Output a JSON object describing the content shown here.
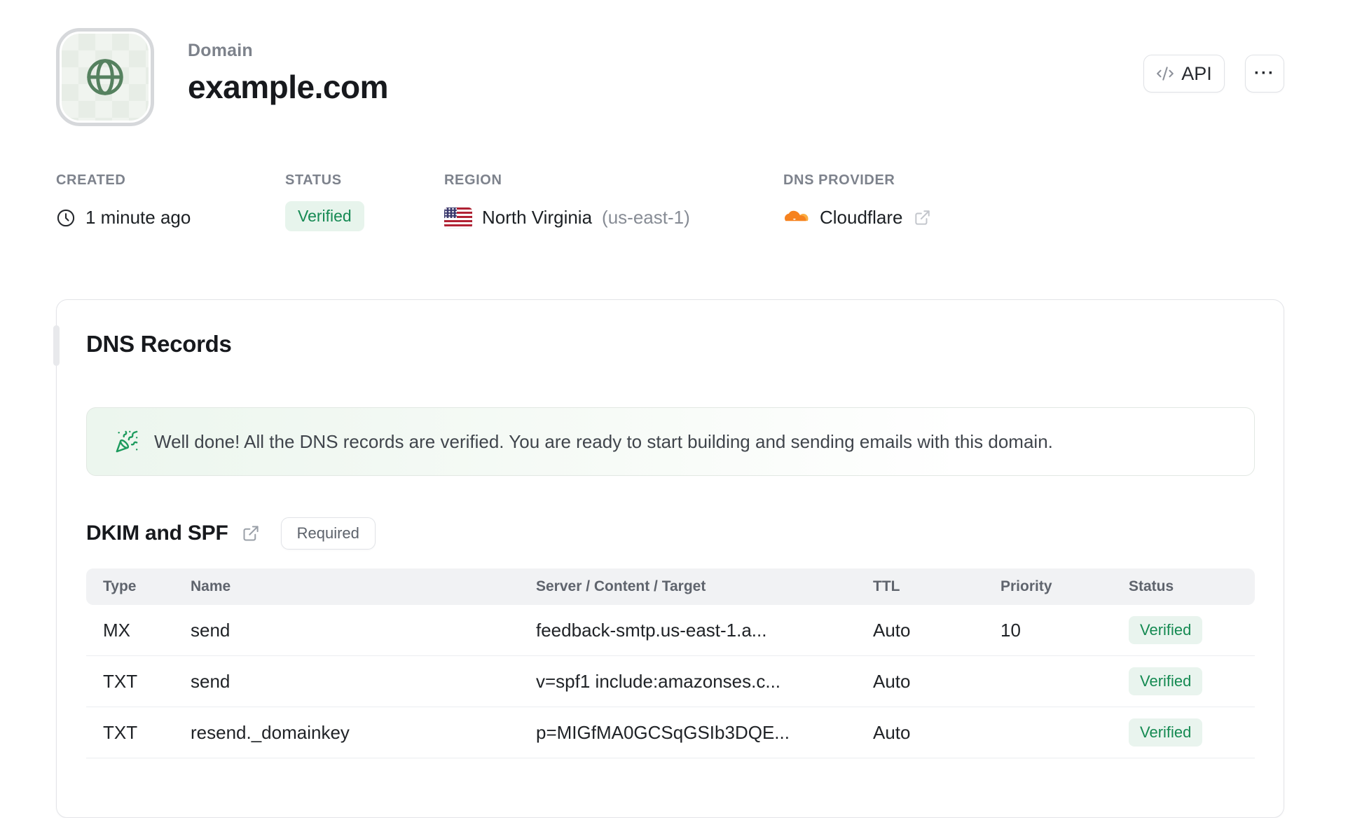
{
  "header": {
    "eyebrow": "Domain",
    "title": "example.com",
    "api_button_label": "API",
    "more_button_label": "···"
  },
  "meta": {
    "created": {
      "label": "CREATED",
      "value": "1 minute ago",
      "icon": "clock-icon"
    },
    "status": {
      "label": "STATUS",
      "value": "Verified"
    },
    "region": {
      "label": "REGION",
      "name": "North Virginia",
      "code": "(us-east-1)",
      "icon": "us-flag-icon"
    },
    "dns_provider": {
      "label": "DNS PROVIDER",
      "value": "Cloudflare",
      "icon": "cloudflare-icon"
    }
  },
  "card": {
    "title": "DNS Records",
    "banner": {
      "message": "Well done! All the DNS records are verified. You are ready to start building and sending emails with this domain.",
      "icon": "party-popper-icon"
    },
    "section": {
      "title": "DKIM and SPF",
      "badge": "Required"
    },
    "table": {
      "columns": [
        "Type",
        "Name",
        "Server / Content / Target",
        "TTL",
        "Priority",
        "Status"
      ],
      "rows": [
        {
          "type": "MX",
          "name": "send",
          "content": "feedback-smtp.us-east-1.a...",
          "ttl": "Auto",
          "priority": "10",
          "status": "Verified"
        },
        {
          "type": "TXT",
          "name": "send",
          "content": "v=spf1 include:amazonses.c...",
          "ttl": "Auto",
          "priority": "",
          "status": "Verified"
        },
        {
          "type": "TXT",
          "name": "resend._domainkey",
          "content": "p=MIGfMA0GCSqGSIb3DQE...",
          "ttl": "Auto",
          "priority": "",
          "status": "Verified"
        }
      ]
    }
  },
  "colors": {
    "accent_green": "#168a54",
    "badge_green_bg": "#e9f4ee",
    "banner_green_bg": "#ecf6ee",
    "globe_green": "#55815f",
    "cloudflare_orange": "#f6821f",
    "cloudflare_orange_light": "#fbad41",
    "text_dark": "#17191d",
    "text_muted": "#7d828c",
    "border": "#e3e4e8",
    "table_header_bg": "#f1f2f4"
  }
}
